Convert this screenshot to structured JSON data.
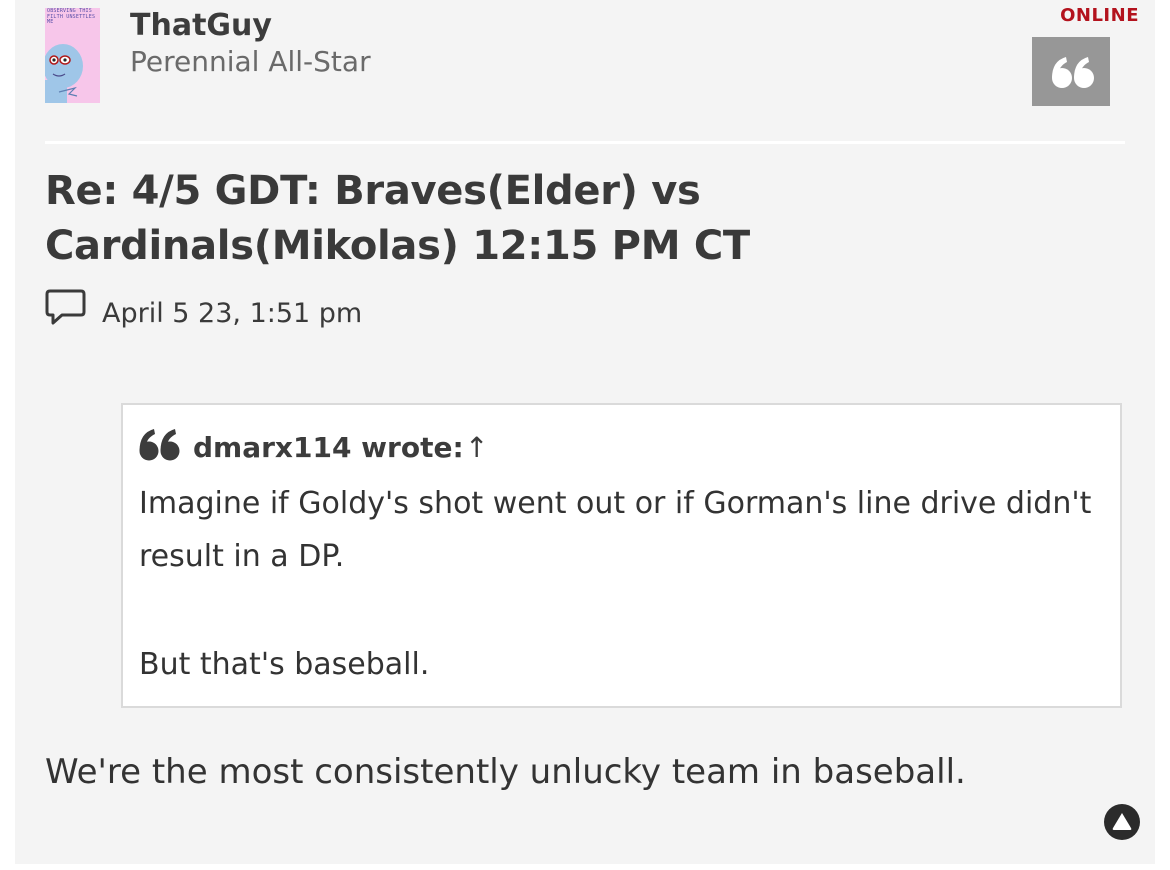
{
  "author": {
    "username": "ThatGuy",
    "rank": "Perennial All-Star",
    "status": "ONLINE",
    "status_color": "#b3121d",
    "avatar_text": "OBSERVING THIS FILTH UNSETTLES ME"
  },
  "post": {
    "title": "Re: 4/5 GDT: Braves(Elder) vs Cardinals(Mikolas) 12:15 PM CT",
    "date": "April 5 23, 1:51 pm",
    "quote": {
      "author_line": "dmarx114 wrote:",
      "arrow": "↑",
      "paragraphs": [
        "Imagine if Goldy's shot went out or if Gorman's line drive didn't result in a DP.",
        "But that's baseball."
      ]
    },
    "body": "We're the most consistently unlucky team in baseball."
  },
  "icons": {
    "quote_button": "quote-icon",
    "post_meta": "comment-icon",
    "quote_mark": "quote-icon",
    "scroll_top": "arrow-up-icon"
  }
}
